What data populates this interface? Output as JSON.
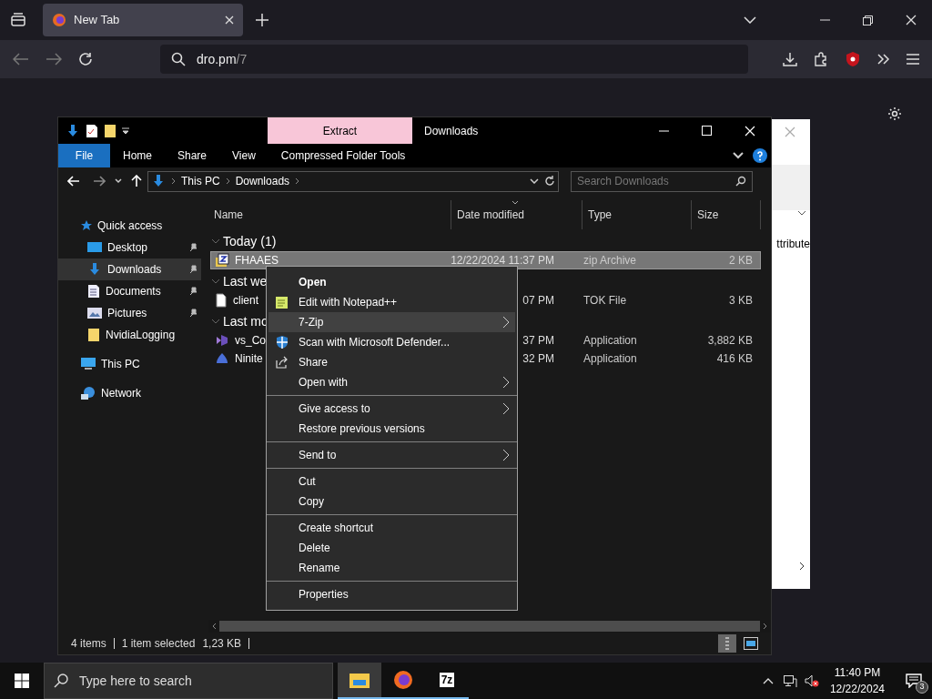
{
  "browser": {
    "tabs": [
      {
        "title": "New Tab",
        "selected": true
      }
    ],
    "url_host": "dro.pm",
    "url_path": "/7"
  },
  "back_window": {
    "text": "ttribute"
  },
  "explorer": {
    "contextual_tab": "Extract",
    "title": "Downloads",
    "ribbon_tabs": [
      {
        "label": "File",
        "selected": true
      },
      {
        "label": "Home",
        "selected": false
      },
      {
        "label": "Share",
        "selected": false
      },
      {
        "label": "View",
        "selected": false
      },
      {
        "label": "Compressed Folder Tools",
        "selected": false
      }
    ],
    "breadcrumb": [
      "This PC",
      "Downloads"
    ],
    "search": {
      "placeholder": "Search Downloads"
    },
    "nav": [
      {
        "label": "Quick access",
        "kind": "star",
        "selected": false,
        "children": [
          {
            "label": "Desktop",
            "kind": "desktop",
            "pinned": true,
            "selected": false
          },
          {
            "label": "Downloads",
            "kind": "download",
            "pinned": true,
            "selected": true
          },
          {
            "label": "Documents",
            "kind": "document",
            "pinned": true,
            "selected": false
          },
          {
            "label": "Pictures",
            "kind": "pictures",
            "pinned": true,
            "selected": false
          },
          {
            "label": "NvidiaLogging",
            "kind": "folder",
            "pinned": false,
            "selected": false
          }
        ]
      },
      {
        "label": "This PC",
        "kind": "pc",
        "selected": false
      },
      {
        "label": "Network",
        "kind": "network",
        "selected": false
      }
    ],
    "columns": [
      "Name",
      "Date modified",
      "Type",
      "Size"
    ],
    "groups": [
      {
        "title": "Today (1)",
        "files": [
          {
            "name": "FHAAES",
            "date": "12/22/2024 11:37 PM",
            "type": "zip Archive",
            "size": "2 KB",
            "kind": "zip",
            "selected": true
          }
        ]
      },
      {
        "title": "Last we",
        "files": [
          {
            "name": "client",
            "date": "07 PM",
            "type": "TOK File",
            "size": "3 KB",
            "kind": "file",
            "selected": false
          }
        ]
      },
      {
        "title": "Last mo",
        "files": [
          {
            "name": "vs_Co",
            "date": "37 PM",
            "type": "Application",
            "size": "3,882 KB",
            "kind": "vs",
            "selected": false
          },
          {
            "name": "Ninite",
            "date": "32 PM",
            "type": "Application",
            "size": "416 KB",
            "kind": "ninite",
            "selected": false
          }
        ]
      }
    ],
    "status": {
      "count": "4 items",
      "selection": "1 item selected",
      "selection_size": "1,23 KB"
    }
  },
  "context_menu": [
    [
      {
        "label": "Open",
        "bold": true,
        "kind": "plain",
        "submenu": false,
        "selected": false
      },
      {
        "label": "Edit with Notepad++",
        "bold": false,
        "kind": "notepad",
        "submenu": false,
        "selected": false
      },
      {
        "label": "7-Zip",
        "bold": false,
        "kind": "plain",
        "submenu": true,
        "selected": true
      },
      {
        "label": "Scan with Microsoft Defender...",
        "bold": false,
        "kind": "shield",
        "submenu": false,
        "selected": false
      },
      {
        "label": "Share",
        "bold": false,
        "kind": "share",
        "submenu": false,
        "selected": false
      },
      {
        "label": "Open with",
        "bold": false,
        "kind": "plain",
        "submenu": true,
        "selected": false
      }
    ],
    [
      {
        "label": "Give access to",
        "bold": false,
        "kind": "plain",
        "submenu": true,
        "selected": false
      },
      {
        "label": "Restore previous versions",
        "bold": false,
        "kind": "plain",
        "submenu": false,
        "selected": false
      }
    ],
    [
      {
        "label": "Send to",
        "bold": false,
        "kind": "plain",
        "submenu": true,
        "selected": false
      }
    ],
    [
      {
        "label": "Cut",
        "bold": false,
        "kind": "plain",
        "submenu": false,
        "selected": false
      },
      {
        "label": "Copy",
        "bold": false,
        "kind": "plain",
        "submenu": false,
        "selected": false
      }
    ],
    [
      {
        "label": "Create shortcut",
        "bold": false,
        "kind": "plain",
        "submenu": false,
        "selected": false
      },
      {
        "label": "Delete",
        "bold": false,
        "kind": "plain",
        "submenu": false,
        "selected": false
      },
      {
        "label": "Rename",
        "bold": false,
        "kind": "plain",
        "submenu": false,
        "selected": false
      }
    ],
    [
      {
        "label": "Properties",
        "bold": false,
        "kind": "plain",
        "submenu": false,
        "selected": false
      }
    ]
  ],
  "taskbar": {
    "search": {
      "placeholder": "Type here to search"
    },
    "apps": [
      {
        "kind": "explorer",
        "active": true
      },
      {
        "kind": "firefox",
        "active": false
      },
      {
        "kind": "sevenzip",
        "active": false
      }
    ],
    "sevenzip_label": "7z",
    "time": "11:40 PM",
    "date": "12/22/2024",
    "notifications": "3"
  }
}
